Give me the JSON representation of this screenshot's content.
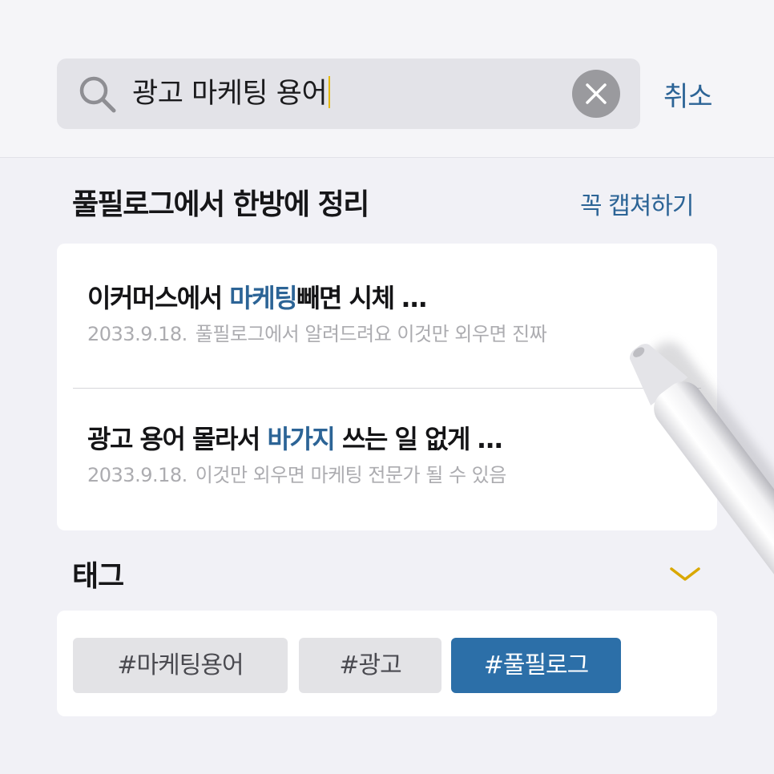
{
  "search": {
    "query": "광고 마케팅 용어",
    "cancel_label": "취소"
  },
  "section": {
    "title": "풀필로그에서 한방에 정리",
    "action_label": "꼭 캡쳐하기"
  },
  "results": [
    {
      "title_before": "이커머스에서 ",
      "title_highlight": "마케팅",
      "title_after": "빼면 시체 …",
      "date": "2033.9.18.",
      "snippet": "풀필로그에서 알려드려요 이것만 외우면 진짜"
    },
    {
      "title_before": "광고 용어 몰라서 ",
      "title_highlight": "바가지",
      "title_after": " 쓰는 일 없게 …",
      "date": "2033.9.18.",
      "snippet": "이것만 외우면 마케팅 전문가 될 수 있음"
    }
  ],
  "tags": {
    "title": "태그",
    "items": [
      {
        "label": "#마케팅용어",
        "selected": false
      },
      {
        "label": "#광고",
        "selected": false
      },
      {
        "label": "#풀필로그",
        "selected": true
      }
    ]
  },
  "colors": {
    "accent": "#2c6496",
    "active_tag": "#2c6fa8",
    "caret": "#e6b800",
    "chevron": "#d9a800"
  }
}
